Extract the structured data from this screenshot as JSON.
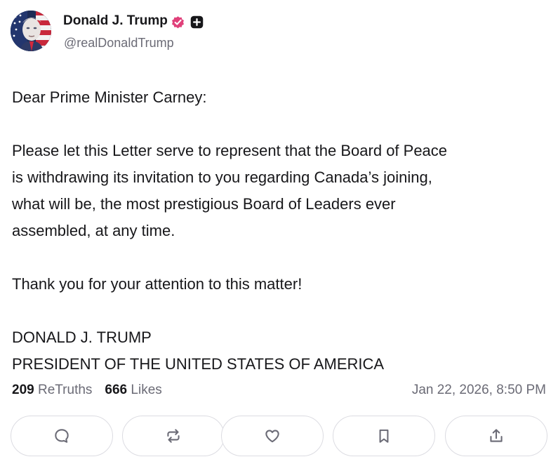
{
  "author": {
    "display_name": "Donald J. Trump",
    "handle": "@realDonaldTrump",
    "avatar_icon": "flag-portrait-avatar",
    "badges": [
      "verified-badge-icon",
      "plus-badge-icon"
    ]
  },
  "post": {
    "body": "Dear Prime Minister Carney:\n\nPlease let this Letter serve to represent that the Board of Peace\nis withdrawing its invitation to you regarding Canada’s joining,\nwhat will be, the most prestigious Board of Leaders ever\nassembled, at any time.\n\nThank you for your attention to this matter!\n\nDONALD J. TRUMP\nPRESIDENT OF THE UNITED STATES OF AMERICA",
    "retruths_count": "209",
    "retruths_label": "ReTruths",
    "likes_count": "666",
    "likes_label": "Likes",
    "timestamp": "Jan 22, 2026, 8:50 PM"
  },
  "actions": [
    {
      "icon": "reply-icon"
    },
    {
      "icon": "retruth-icon"
    },
    {
      "icon": "like-icon"
    },
    {
      "icon": "bookmark-icon"
    },
    {
      "icon": "share-icon"
    }
  ],
  "colors": {
    "verified_badge": "#e0407a",
    "text_primary": "#17171a",
    "text_secondary": "#6b6b76",
    "button_border": "#dcdce2"
  }
}
